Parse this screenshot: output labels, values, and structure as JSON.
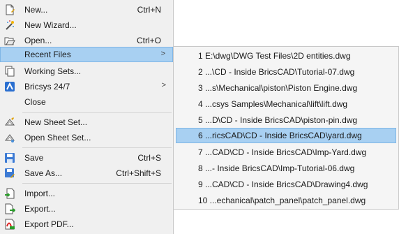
{
  "menu": {
    "items": [
      {
        "label": "New...",
        "shortcut": "Ctrl+N",
        "icon": "new-file-icon"
      },
      {
        "label": "New Wizard...",
        "shortcut": "",
        "icon": "wizard-icon"
      },
      {
        "label": "Open...",
        "shortcut": "Ctrl+O",
        "icon": "open-folder-icon"
      },
      {
        "label": "Recent Files",
        "shortcut": "",
        "icon": "",
        "has_submenu": true
      },
      {
        "label": "Working Sets...",
        "shortcut": "",
        "icon": "working-sets-icon"
      },
      {
        "label": "Bricsys 24/7",
        "shortcut": "",
        "icon": "bricsys-icon",
        "has_submenu": true
      },
      {
        "label": "Close",
        "shortcut": "",
        "icon": ""
      },
      {
        "label": "New Sheet Set...",
        "shortcut": "",
        "icon": "new-sheet-set-icon"
      },
      {
        "label": "Open Sheet Set...",
        "shortcut": "",
        "icon": "open-sheet-set-icon"
      },
      {
        "label": "Save",
        "shortcut": "Ctrl+S",
        "icon": "save-icon"
      },
      {
        "label": "Save As...",
        "shortcut": "Ctrl+Shift+S",
        "icon": "save-as-icon"
      },
      {
        "label": "Import...",
        "shortcut": "",
        "icon": "import-icon"
      },
      {
        "label": "Export...",
        "shortcut": "",
        "icon": "export-icon"
      },
      {
        "label": "Export PDF...",
        "shortcut": "",
        "icon": "export-pdf-icon"
      }
    ],
    "submenu_arrow": ">"
  },
  "recent_files": [
    "1 E:\\dwg\\DWG Test Files\\2D entities.dwg",
    "2 ...\\CD - Inside BricsCAD\\Tutorial-07.dwg",
    "3 ...s\\Mechanical\\piston\\Piston Engine.dwg",
    "4 ...csys Samples\\Mechanical\\lift\\lift.dwg",
    "5 ...D\\CD - Inside BricsCAD\\piston-pin.dwg",
    "6 ...ricsCAD\\CD - Inside BricsCAD\\yard.dwg",
    "7 ...CAD\\CD - Inside BricsCAD\\Imp-Yard.dwg",
    "8 ...- Inside BricsCAD\\Imp-Tutorial-06.dwg",
    "9 ...CAD\\CD - Inside BricsCAD\\Drawing4.dwg",
    "10 ...echanical\\patch_panel\\patch_panel.dwg"
  ],
  "colors": {
    "selected_bg": "#a8d0f2",
    "selected_border": "#7fb6e6",
    "menu_bg": "#f0f0f0"
  }
}
